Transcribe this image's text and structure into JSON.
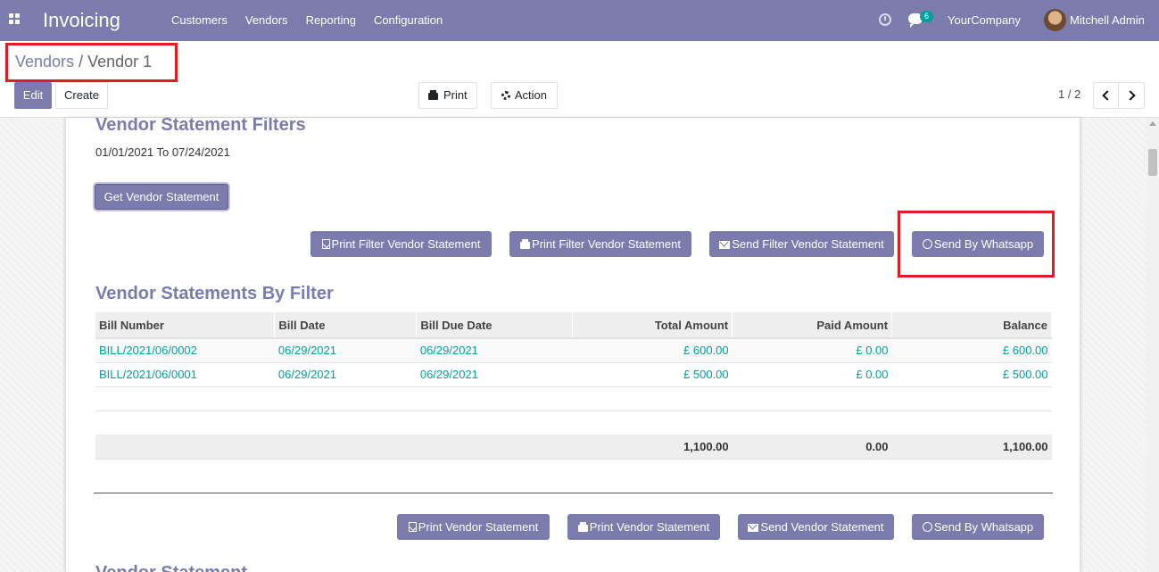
{
  "navbar": {
    "app_title": "Invoicing",
    "menu": [
      "Customers",
      "Vendors",
      "Reporting",
      "Configuration"
    ],
    "message_count": "6",
    "company": "YourCompany",
    "user": "Mitchell Admin"
  },
  "breadcrumb": {
    "parent": "Vendors",
    "separator": "/",
    "current": "Vendor 1"
  },
  "toolbar": {
    "edit": "Edit",
    "create": "Create",
    "print": "Print",
    "action": "Action",
    "pager": "1 / 2"
  },
  "filters": {
    "title": "Vendor Statement Filters",
    "date_from": "01/01/2021",
    "to_label": "To",
    "date_to": "07/24/2021",
    "get_button": "Get Vendor Statement",
    "buttons": [
      "Print Filter Vendor Statement",
      "Print Filter Vendor Statement",
      "Send Filter Vendor Statement",
      "Send By Whatsapp"
    ]
  },
  "by_filter": {
    "title": "Vendor Statements By Filter",
    "columns": [
      "Bill Number",
      "Bill Date",
      "Bill Due Date",
      "Total Amount",
      "Paid Amount",
      "Balance"
    ],
    "rows": [
      [
        "BILL/2021/06/0002",
        "06/29/2021",
        "06/29/2021",
        "£ 600.00",
        "£ 0.00",
        "£ 600.00"
      ],
      [
        "BILL/2021/06/0001",
        "06/29/2021",
        "06/29/2021",
        "£ 500.00",
        "£ 0.00",
        "£ 500.00"
      ]
    ],
    "totals": [
      "1,100.00",
      "0.00",
      "1,100.00"
    ]
  },
  "statement": {
    "buttons": [
      "Print Vendor Statement",
      "Print Vendor Statement",
      "Send Vendor Statement",
      "Send By Whatsapp"
    ],
    "title_partial": "Vendor Statement"
  },
  "colors": {
    "brand": "#7c7bad",
    "link": "#00a09d",
    "highlight": "#e21d22"
  }
}
